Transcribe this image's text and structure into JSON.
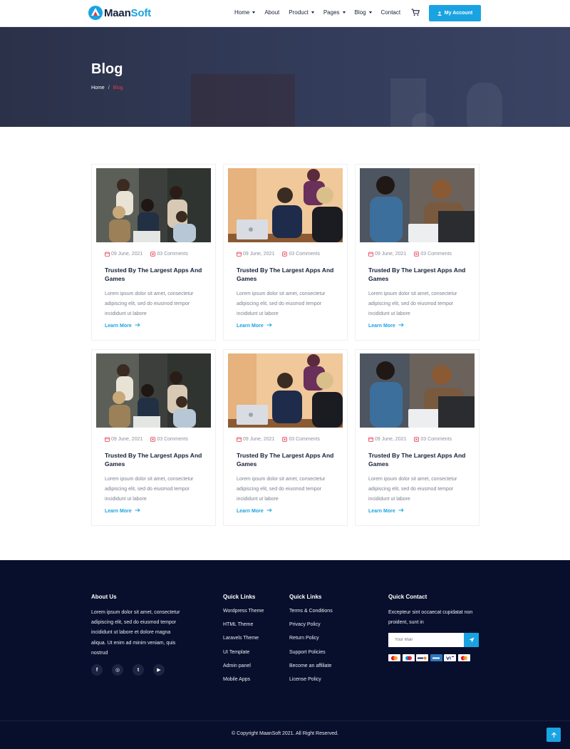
{
  "brand": {
    "name_a": "Maan",
    "name_b": "Soft"
  },
  "nav": {
    "items": [
      "Home",
      "About",
      "Product",
      "Pages",
      "Blog",
      "Contact"
    ],
    "account_label": "My Account",
    "icons": {
      "cart": "cart-icon",
      "account": "user-icon"
    }
  },
  "hero": {
    "title": "Blog",
    "breadcrumb": {
      "home": "Home",
      "sep": "/",
      "current": "Blog"
    }
  },
  "posts": [
    {
      "date": "09 June, 2021",
      "comments": "03 Comments",
      "title": "Trusted By The Largest Apps And Games",
      "excerpt": "Lorem ipsum dolor sit amet, consectetur adipiscing elit, sed do eiusmod tempor incididunt ut labore",
      "cta": "Learn More"
    },
    {
      "date": "09 June, 2021",
      "comments": "03 Comments",
      "title": "Trusted By The Largest Apps And Games",
      "excerpt": "Lorem ipsum dolor sit amet, consectetur adipiscing elit, sed do eiusmod tempor incididunt ut labore",
      "cta": "Learn More"
    },
    {
      "date": "09 June, 2021",
      "comments": "03 Comments",
      "title": "Trusted By The Largest Apps And Games",
      "excerpt": "Lorem ipsum dolor sit amet, consectetur adipiscing elit, sed do eiusmod tempor incididunt ut labore",
      "cta": "Learn More"
    },
    {
      "date": "09 June, 2021",
      "comments": "03 Comments",
      "title": "Trusted By The Largest Apps And Games",
      "excerpt": "Lorem ipsum dolor sit amet, consectetur adipiscing elit, sed do eiusmod tempor incididunt ut labore",
      "cta": "Learn More"
    },
    {
      "date": "09 June, 2021",
      "comments": "03 Comments",
      "title": "Trusted By The Largest Apps And Games",
      "excerpt": "Lorem ipsum dolor sit amet, consectetur adipiscing elit, sed do eiusmod tempor incididunt ut labore",
      "cta": "Learn More"
    },
    {
      "date": "09 June, 2021",
      "comments": "03 Comments",
      "title": "Trusted By The Largest Apps And Games",
      "excerpt": "Lorem ipsum dolor sit amet, consectetur adipiscing elit, sed do eiusmod tempor incididunt ut labore",
      "cta": "Learn More"
    }
  ],
  "footer": {
    "about": {
      "heading": "About Us",
      "text": "Lorem ipsum dolor sit amet, consectetur adipiscing elit, sed do eiusmod tempor incididunt ut labore et dolore magna aliqua. Ut enim ad minim veniam, quis nostrud",
      "socials": [
        {
          "icon": "facebook-icon",
          "glyph": "f"
        },
        {
          "icon": "instagram-icon",
          "glyph": "◎"
        },
        {
          "icon": "twitter-icon",
          "glyph": "t"
        },
        {
          "icon": "youtube-icon",
          "glyph": "▶"
        }
      ]
    },
    "quick_links_1": {
      "heading": "Quick Links",
      "items": [
        "Wordpress Theme",
        "HTML Theme",
        "Laravels Theme",
        "UI Template",
        "Admin panel",
        "Mobile Apps"
      ]
    },
    "quick_links_2": {
      "heading": "Quick Links",
      "items": [
        "Terms & Conditions",
        "Privacy Policy",
        "Return Policy",
        "Support Policies",
        "Become an affiliate",
        "License Policy"
      ]
    },
    "contact": {
      "heading": "Quick Contact",
      "text": "Excepteur sint occaecat cupidatat non proident, sunt in",
      "mail_placeholder": "Your Mail",
      "send_icon": "send-icon",
      "payments": [
        "mastercard-icon",
        "maestro-icon",
        "discover-icon",
        "amex-icon",
        "visa-icon",
        "mastercard-icon"
      ]
    },
    "copyright": "© Copyright MaanSoft 2021. All Right Reserved.",
    "back_to_top_icon": "arrow-up-icon"
  },
  "colors": {
    "accent": "#1aa3e2",
    "highlight": "#e8384f",
    "footer_bg": "#080f2c",
    "hero_bg": "#2f3650"
  }
}
